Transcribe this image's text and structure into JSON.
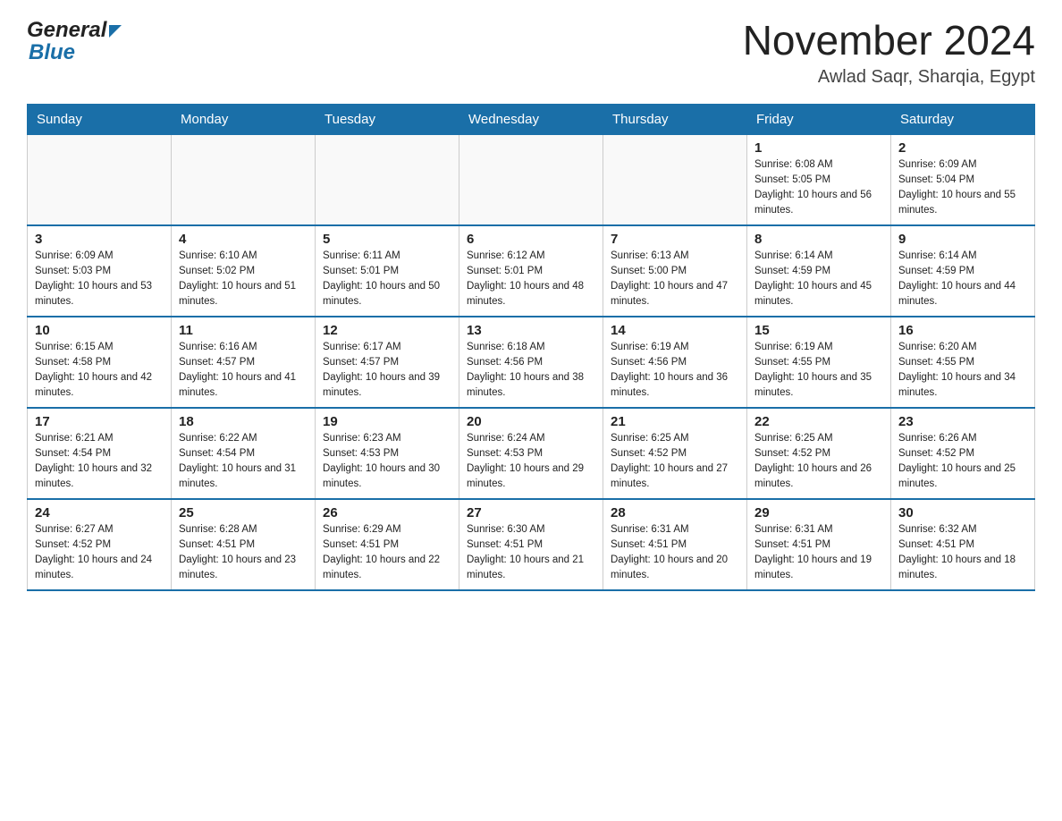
{
  "header": {
    "logo": {
      "general_text": "General",
      "blue_text": "Blue"
    },
    "month_title": "November 2024",
    "location": "Awlad Saqr, Sharqia, Egypt"
  },
  "days_of_week": [
    "Sunday",
    "Monday",
    "Tuesday",
    "Wednesday",
    "Thursday",
    "Friday",
    "Saturday"
  ],
  "weeks": [
    [
      {
        "day": "",
        "info": ""
      },
      {
        "day": "",
        "info": ""
      },
      {
        "day": "",
        "info": ""
      },
      {
        "day": "",
        "info": ""
      },
      {
        "day": "",
        "info": ""
      },
      {
        "day": "1",
        "info": "Sunrise: 6:08 AM\nSunset: 5:05 PM\nDaylight: 10 hours and 56 minutes."
      },
      {
        "day": "2",
        "info": "Sunrise: 6:09 AM\nSunset: 5:04 PM\nDaylight: 10 hours and 55 minutes."
      }
    ],
    [
      {
        "day": "3",
        "info": "Sunrise: 6:09 AM\nSunset: 5:03 PM\nDaylight: 10 hours and 53 minutes."
      },
      {
        "day": "4",
        "info": "Sunrise: 6:10 AM\nSunset: 5:02 PM\nDaylight: 10 hours and 51 minutes."
      },
      {
        "day": "5",
        "info": "Sunrise: 6:11 AM\nSunset: 5:01 PM\nDaylight: 10 hours and 50 minutes."
      },
      {
        "day": "6",
        "info": "Sunrise: 6:12 AM\nSunset: 5:01 PM\nDaylight: 10 hours and 48 minutes."
      },
      {
        "day": "7",
        "info": "Sunrise: 6:13 AM\nSunset: 5:00 PM\nDaylight: 10 hours and 47 minutes."
      },
      {
        "day": "8",
        "info": "Sunrise: 6:14 AM\nSunset: 4:59 PM\nDaylight: 10 hours and 45 minutes."
      },
      {
        "day": "9",
        "info": "Sunrise: 6:14 AM\nSunset: 4:59 PM\nDaylight: 10 hours and 44 minutes."
      }
    ],
    [
      {
        "day": "10",
        "info": "Sunrise: 6:15 AM\nSunset: 4:58 PM\nDaylight: 10 hours and 42 minutes."
      },
      {
        "day": "11",
        "info": "Sunrise: 6:16 AM\nSunset: 4:57 PM\nDaylight: 10 hours and 41 minutes."
      },
      {
        "day": "12",
        "info": "Sunrise: 6:17 AM\nSunset: 4:57 PM\nDaylight: 10 hours and 39 minutes."
      },
      {
        "day": "13",
        "info": "Sunrise: 6:18 AM\nSunset: 4:56 PM\nDaylight: 10 hours and 38 minutes."
      },
      {
        "day": "14",
        "info": "Sunrise: 6:19 AM\nSunset: 4:56 PM\nDaylight: 10 hours and 36 minutes."
      },
      {
        "day": "15",
        "info": "Sunrise: 6:19 AM\nSunset: 4:55 PM\nDaylight: 10 hours and 35 minutes."
      },
      {
        "day": "16",
        "info": "Sunrise: 6:20 AM\nSunset: 4:55 PM\nDaylight: 10 hours and 34 minutes."
      }
    ],
    [
      {
        "day": "17",
        "info": "Sunrise: 6:21 AM\nSunset: 4:54 PM\nDaylight: 10 hours and 32 minutes."
      },
      {
        "day": "18",
        "info": "Sunrise: 6:22 AM\nSunset: 4:54 PM\nDaylight: 10 hours and 31 minutes."
      },
      {
        "day": "19",
        "info": "Sunrise: 6:23 AM\nSunset: 4:53 PM\nDaylight: 10 hours and 30 minutes."
      },
      {
        "day": "20",
        "info": "Sunrise: 6:24 AM\nSunset: 4:53 PM\nDaylight: 10 hours and 29 minutes."
      },
      {
        "day": "21",
        "info": "Sunrise: 6:25 AM\nSunset: 4:52 PM\nDaylight: 10 hours and 27 minutes."
      },
      {
        "day": "22",
        "info": "Sunrise: 6:25 AM\nSunset: 4:52 PM\nDaylight: 10 hours and 26 minutes."
      },
      {
        "day": "23",
        "info": "Sunrise: 6:26 AM\nSunset: 4:52 PM\nDaylight: 10 hours and 25 minutes."
      }
    ],
    [
      {
        "day": "24",
        "info": "Sunrise: 6:27 AM\nSunset: 4:52 PM\nDaylight: 10 hours and 24 minutes."
      },
      {
        "day": "25",
        "info": "Sunrise: 6:28 AM\nSunset: 4:51 PM\nDaylight: 10 hours and 23 minutes."
      },
      {
        "day": "26",
        "info": "Sunrise: 6:29 AM\nSunset: 4:51 PM\nDaylight: 10 hours and 22 minutes."
      },
      {
        "day": "27",
        "info": "Sunrise: 6:30 AM\nSunset: 4:51 PM\nDaylight: 10 hours and 21 minutes."
      },
      {
        "day": "28",
        "info": "Sunrise: 6:31 AM\nSunset: 4:51 PM\nDaylight: 10 hours and 20 minutes."
      },
      {
        "day": "29",
        "info": "Sunrise: 6:31 AM\nSunset: 4:51 PM\nDaylight: 10 hours and 19 minutes."
      },
      {
        "day": "30",
        "info": "Sunrise: 6:32 AM\nSunset: 4:51 PM\nDaylight: 10 hours and 18 minutes."
      }
    ]
  ]
}
